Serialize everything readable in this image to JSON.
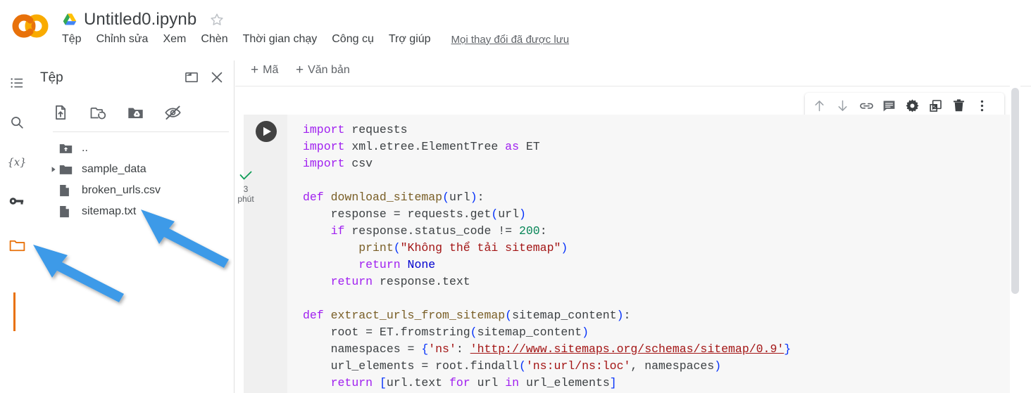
{
  "app": {
    "logo_alt": "colab-logo",
    "doc_title": "Untitled0.ipynb",
    "drive_icon": "google-drive-icon",
    "star_icon": "star-outline-icon"
  },
  "menubar": {
    "items": [
      {
        "label": "Tệp"
      },
      {
        "label": "Chỉnh sửa"
      },
      {
        "label": "Xem"
      },
      {
        "label": "Chèn"
      },
      {
        "label": "Thời gian chạy"
      },
      {
        "label": "Công cụ"
      },
      {
        "label": "Trợ giúp"
      }
    ],
    "save_status": "Mọi thay đổi đã được lưu"
  },
  "rail": {
    "items": [
      {
        "name": "table-of-contents-icon",
        "active": false
      },
      {
        "name": "search-icon",
        "active": false
      },
      {
        "name": "variables-icon",
        "active": false
      },
      {
        "name": "secrets-key-icon",
        "active": false
      },
      {
        "name": "files-folder-icon",
        "active": true
      }
    ],
    "active_color": "#e8710a"
  },
  "files_panel": {
    "title": "Tệp",
    "header_icons": [
      {
        "name": "open-in-new-window-icon"
      },
      {
        "name": "close-icon"
      }
    ],
    "toolbar_icons": [
      {
        "name": "upload-file-icon"
      },
      {
        "name": "refresh-folder-icon"
      },
      {
        "name": "mount-drive-icon"
      },
      {
        "name": "toggle-hidden-files-icon"
      }
    ],
    "tree": [
      {
        "label": "..",
        "type": "parent-folder",
        "expandable": false
      },
      {
        "label": "sample_data",
        "type": "folder",
        "expandable": true
      },
      {
        "label": "broken_urls.csv",
        "type": "file",
        "expandable": false
      },
      {
        "label": "sitemap.txt",
        "type": "file",
        "expandable": false
      }
    ]
  },
  "notebook": {
    "add_code_label": "Mã",
    "add_text_label": "Văn bản",
    "add_plus": "+",
    "cell_toolbar_icons": [
      {
        "name": "move-cell-up-icon"
      },
      {
        "name": "move-cell-down-icon"
      },
      {
        "name": "link-to-cell-icon"
      },
      {
        "name": "add-comment-icon"
      },
      {
        "name": "cell-settings-gear-icon"
      },
      {
        "name": "mirror-cell-icon"
      },
      {
        "name": "delete-cell-icon"
      },
      {
        "name": "more-cell-actions-icon"
      }
    ],
    "cell": {
      "run_button": "run-cell-icon",
      "status_check": "execution-success-check-icon",
      "run_time_value": "3",
      "run_time_unit": "phút",
      "code_lines": [
        "import requests",
        "import xml.etree.ElementTree as ET",
        "import csv",
        "",
        "def download_sitemap(url):",
        "    response = requests.get(url)",
        "    if response.status_code != 200:",
        "        print(\"Không thể tải sitemap\")",
        "        return None",
        "    return response.text",
        "",
        "def extract_urls_from_sitemap(sitemap_content):",
        "    root = ET.fromstring(sitemap_content)",
        "    namespaces = {'ns': 'http://www.sitemaps.org/schemas/sitemap/0.9'}",
        "    url_elements = root.findall('ns:url/ns:loc', namespaces)",
        "    return [url.text for url in url_elements]"
      ],
      "linked_url": "http://www.sitemaps.org/schemas/sitemap/0.9"
    }
  },
  "scrollbar": {
    "name": "notebook-vertical-scrollbar"
  },
  "annotations": {
    "arrow_color": "#3d9ae8",
    "arrows": [
      {
        "name": "arrow-pointing-to-sitemap-file"
      },
      {
        "name": "arrow-pointing-to-files-rail-icon"
      }
    ]
  },
  "colors": {
    "accent_orange": "#e8710a",
    "cell_bg": "#f7f7f7",
    "gutter_bg": "#f0f0f0",
    "text": "#3c4043"
  }
}
